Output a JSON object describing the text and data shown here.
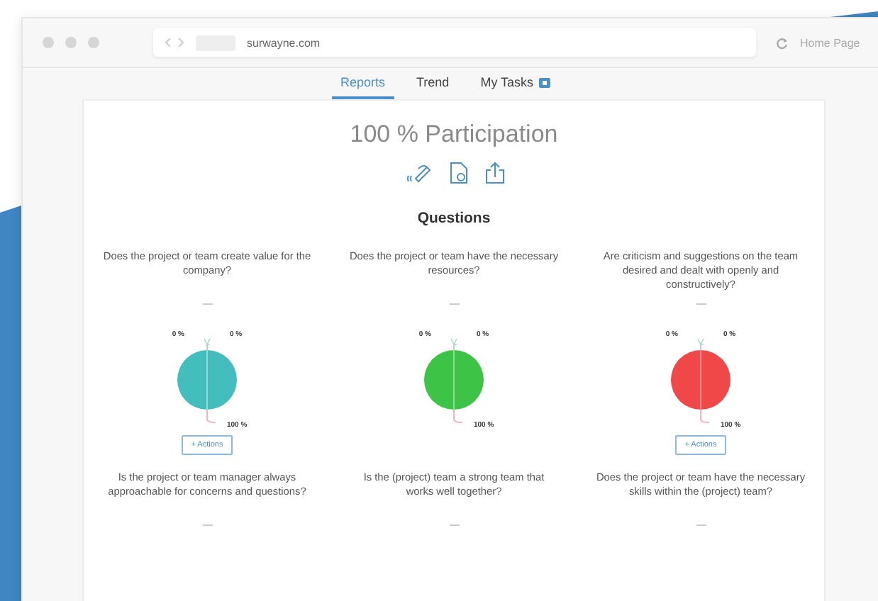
{
  "browser": {
    "url": "surwayne.com",
    "home": "Home Page"
  },
  "tabs": [
    {
      "label": "Reports",
      "selected": true,
      "badge": false
    },
    {
      "label": "Trend",
      "selected": false,
      "badge": false
    },
    {
      "label": "My Tasks",
      "selected": false,
      "badge": true
    }
  ],
  "title": "100 % Participation",
  "section_title": "Questions",
  "questions": [
    {
      "text": "Does the project or team create value for the company?",
      "chart_data": {
        "type": "pie",
        "series": [
          {
            "color": "#44bdbd",
            "values": [
              0,
              0,
              100
            ]
          }
        ],
        "value_labels": [
          "0 %",
          "0 %",
          "100 %"
        ]
      },
      "action": "+ Actions"
    },
    {
      "text": "Does the project or team have the necessary resources?",
      "chart_data": {
        "type": "pie",
        "series": [
          {
            "color": "#3dc447",
            "values": [
              0,
              0,
              100
            ]
          }
        ],
        "value_labels": [
          "0 %",
          "0 %",
          "100 %"
        ]
      }
    },
    {
      "text": "Are criticism and suggestions on the team desired and dealt with openly and constructively?",
      "chart_data": {
        "type": "pie",
        "series": [
          {
            "color": "#f04848",
            "values": [
              0,
              0,
              100
            ]
          }
        ],
        "value_labels": [
          "0 %",
          "0 %",
          "100 %"
        ]
      },
      "action": "+ Actions"
    },
    {
      "text": "Is the project or team manager always approachable for concerns and questions?"
    },
    {
      "text": "Is the (project) team a strong team that works well together?"
    },
    {
      "text": "Does the project or team have the necessary skills within the (project) team?"
    }
  ]
}
